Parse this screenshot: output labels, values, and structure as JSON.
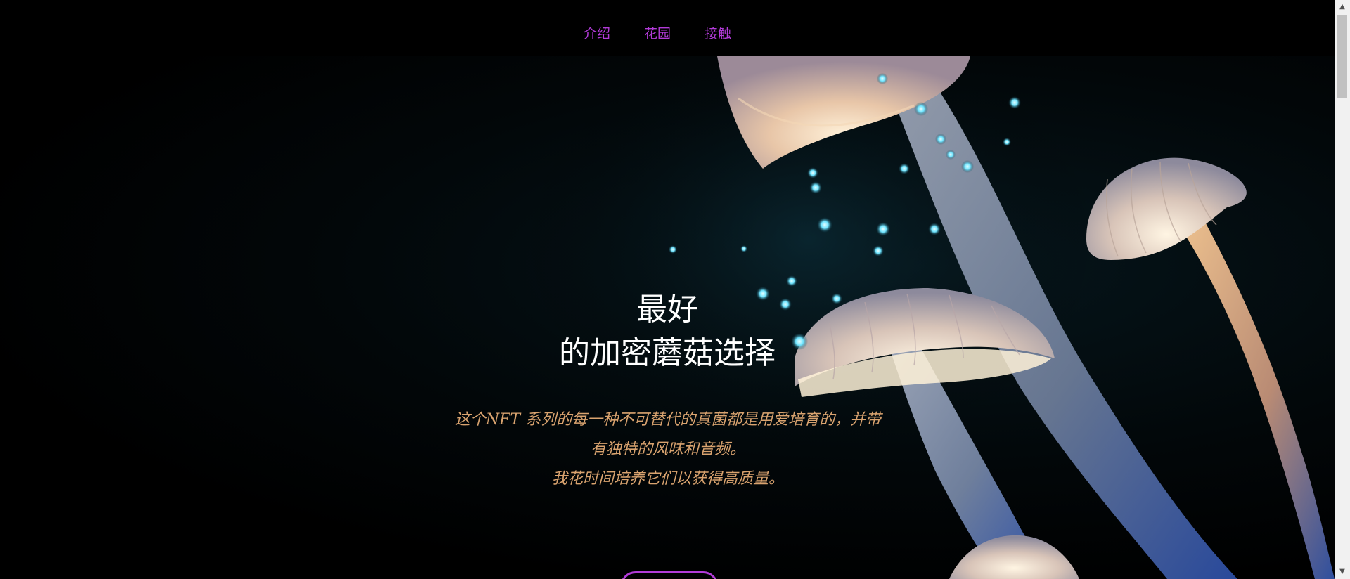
{
  "nav": {
    "items": [
      {
        "label": "介绍"
      },
      {
        "label": "花园"
      },
      {
        "label": "接触"
      }
    ],
    "link_color": "#b23bd8"
  },
  "hero": {
    "headline_line1": "最好",
    "headline_line2": "的加密蘑菇选择",
    "subtitle_line1": "这个NFT 系列的每一种不可替代的真菌都是用爱培育的，并带",
    "subtitle_line2": "有独特的风味和音频。",
    "subtitle_line3": "我花时间培养它们以获得高质量。",
    "subtitle_color": "#d9a36f",
    "image_icon": "glowing-mushrooms-illustration"
  },
  "scrollbar": {
    "up_icon": "▲",
    "down_icon": "▼"
  }
}
